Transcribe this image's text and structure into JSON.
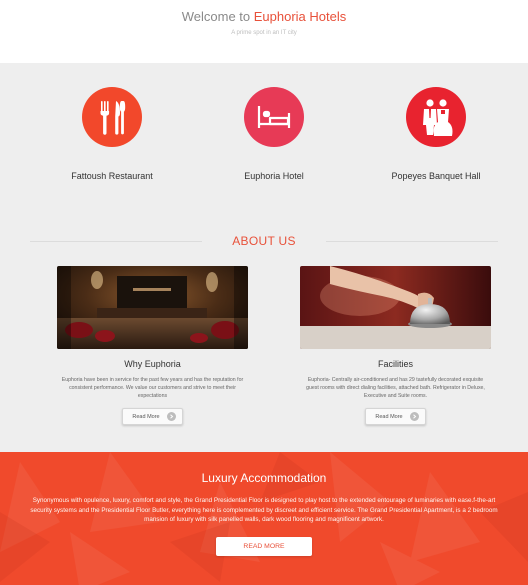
{
  "header": {
    "welcome_prefix": "Welcome to ",
    "brand": "Euphoria Hotels",
    "tagline": "A prime spot in an IT city"
  },
  "services": [
    {
      "name": "Fattoush Restaurant",
      "icon": "cutlery-icon",
      "color": "#f2482b"
    },
    {
      "name": "Euphoria Hotel",
      "icon": "bed-icon",
      "color": "#e73a56"
    },
    {
      "name": "Popeyes Banquet Hall",
      "icon": "couple-icon",
      "color": "#e8232f"
    }
  ],
  "about": {
    "title": "ABOUT US",
    "columns": [
      {
        "image_icon": "lobby-photo",
        "title": "Why Euphoria",
        "text": "Euphoria have been in service for the past few years and has the reputation for consistent performance. We value our customers and strive to meet their expectations",
        "button": "Read More"
      },
      {
        "image_icon": "service-bell-photo",
        "title": "Facilities",
        "text": "Euphoria- Centrally air-conditioned and has 29 tastefully decorated exquisite guest rooms with direct dialing facilities, attached bath. Refrigerator in Deluxe, Executive and Suite rooms.",
        "button": "Read More"
      }
    ]
  },
  "luxury": {
    "title": "Luxury Accommodation",
    "text": "Synonymous with opulence, luxury, comfort and style, the Grand Presidential Floor is designed to play host to the extended entourage of luminaries with ease.f-the-art security systems and the Presidential Floor Butler, everything here is complemented by discreet and efficient service. The Grand Presidential Apartment, is a 2 bedroom mansion of luxury with silk panelled walls, dark wood flooring and magnificent artwork.",
    "button": "READ MORE"
  },
  "colors": {
    "accent": "#e8513a",
    "band": "#eeeeee",
    "luxury_bg": "#f04a2c"
  }
}
